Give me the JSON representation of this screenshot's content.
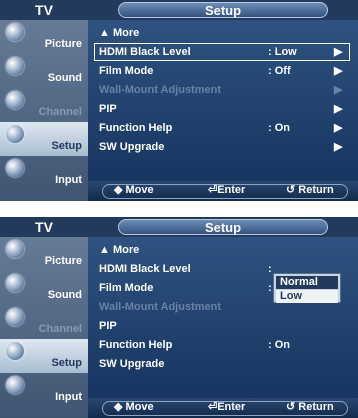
{
  "screens": [
    {
      "rail": {
        "title": "TV",
        "items": [
          {
            "label": "Picture",
            "icon": "picture-icon"
          },
          {
            "label": "Sound",
            "icon": "sound-icon"
          },
          {
            "label": "Channel",
            "icon": "channel-icon"
          },
          {
            "label": "Setup",
            "icon": "setup-icon"
          },
          {
            "label": "Input",
            "icon": "input-icon"
          }
        ]
      },
      "header": {
        "title": "Setup"
      },
      "menu": {
        "more": "▲ More",
        "rows": [
          {
            "name": "HDMI Black Level",
            "value": ": Low",
            "arrow": "▶"
          },
          {
            "name": "Film Mode",
            "value": ": Off",
            "arrow": "▶"
          },
          {
            "name": "Wall-Mount Adjustment",
            "value": "",
            "arrow": "▶"
          },
          {
            "name": "PIP",
            "value": "",
            "arrow": "▶"
          },
          {
            "name": "Function Help",
            "value": ": On",
            "arrow": "▶"
          },
          {
            "name": "SW Upgrade",
            "value": "",
            "arrow": "▶"
          }
        ]
      },
      "footer": {
        "move": "◆ Move",
        "enter": "⏎Enter",
        "return": "↺ Return"
      }
    },
    {
      "rail": {
        "title": "TV",
        "items": [
          {
            "label": "Picture",
            "icon": "picture-icon"
          },
          {
            "label": "Sound",
            "icon": "sound-icon"
          },
          {
            "label": "Channel",
            "icon": "channel-icon"
          },
          {
            "label": "Setup",
            "icon": "setup-icon"
          },
          {
            "label": "Input",
            "icon": "input-icon"
          }
        ]
      },
      "header": {
        "title": "Setup"
      },
      "menu": {
        "more": "▲ More",
        "rows": [
          {
            "name": "HDMI Black Level",
            "value": ":"
          },
          {
            "name": "Film Mode",
            "value": ":"
          },
          {
            "name": "Wall-Mount Adjustment",
            "value": ""
          },
          {
            "name": "PIP",
            "value": ""
          },
          {
            "name": "Function Help",
            "value": ": On"
          },
          {
            "name": "SW Upgrade",
            "value": ""
          }
        ]
      },
      "dropdown": {
        "options": [
          "Normal",
          "Low"
        ],
        "selected": "Normal"
      },
      "footer": {
        "move": "◆ Move",
        "enter": "⏎Enter",
        "return": "↺ Return"
      }
    }
  ],
  "colors": {
    "accent": "#223a5c",
    "menu_bg": "#173560",
    "text": "#ffffff",
    "dim_text": "#6a82a3"
  }
}
